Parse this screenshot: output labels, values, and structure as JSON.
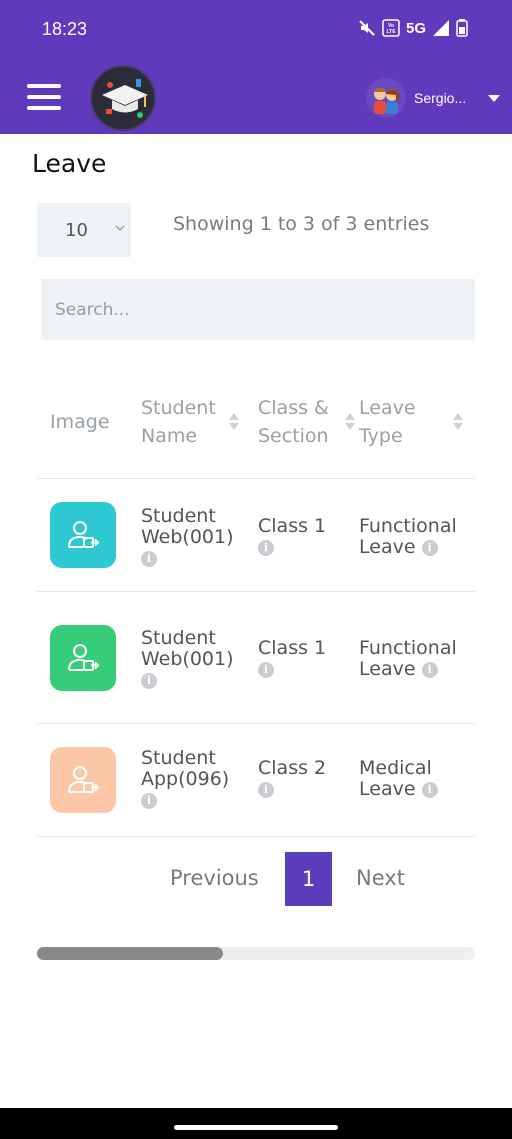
{
  "status_bar": {
    "time": "18:23",
    "network": "5G",
    "volte_label": "Vo LTE"
  },
  "header": {
    "user_name": "Sergio..."
  },
  "page": {
    "title": "Leave"
  },
  "length_menu": {
    "selected": "10"
  },
  "table_info": "Showing 1 to 3 of 3 entries",
  "search": {
    "placeholder": "Search..."
  },
  "table": {
    "columns": [
      {
        "label": "Image"
      },
      {
        "label": "Student Name"
      },
      {
        "label": "Class & Section"
      },
      {
        "label": "Leave Type"
      }
    ],
    "rows": [
      {
        "icon_color": "#2ec8d2",
        "student": "Student Web(001)",
        "class": "Class 1",
        "leave_type": "Functional Leave"
      },
      {
        "icon_color": "#37cc7a",
        "student": "Student Web(001)",
        "class": "Class 1",
        "leave_type": "Functional Leave"
      },
      {
        "icon_color": "#fbc7a6",
        "student": "Student App(096)",
        "class": "Class 2",
        "leave_type": "Medical Leave"
      }
    ]
  },
  "pagination": {
    "previous": "Previous",
    "current": "1",
    "next": "Next"
  },
  "colors": {
    "brand": "#6039bd",
    "page_active": "#5b3dbb"
  }
}
